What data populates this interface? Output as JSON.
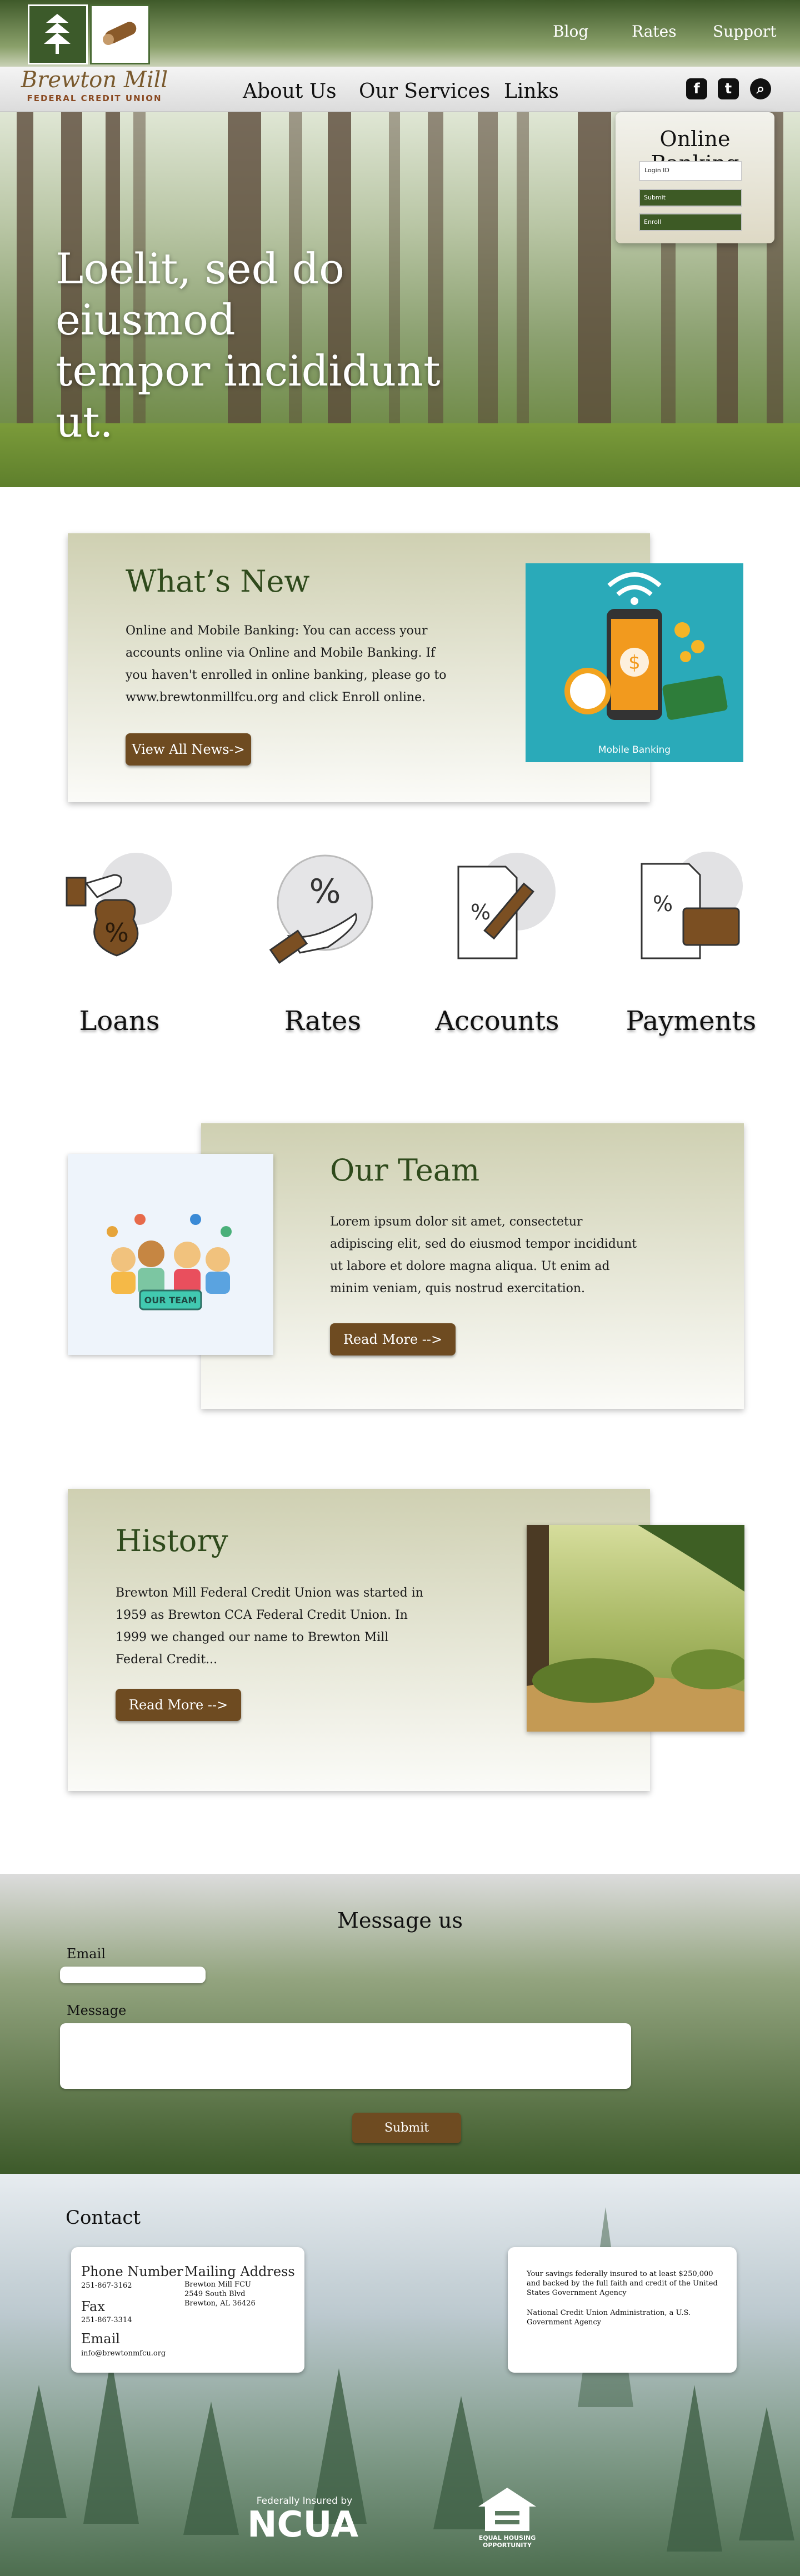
{
  "brand": {
    "name": "Brewton Mill",
    "subtitle": "FEDERAL CREDIT UNION"
  },
  "top_nav": {
    "blog": "Blog",
    "rates": "Rates",
    "support": "Support"
  },
  "main_nav": {
    "about": "About Us",
    "services": "Our Services",
    "links": "Links"
  },
  "social": {
    "facebook": "f",
    "twitter": "t",
    "search": "⌕"
  },
  "icons": {
    "facebook": "facebook-icon",
    "twitter": "twitter-icon",
    "search": "search-icon"
  },
  "hero": {
    "title_line1": "Loelit, sed do eiusmod",
    "title_line2": "tempor incididunt ut."
  },
  "online_banking": {
    "title": "Online Banking",
    "login_placeholder": "Login ID",
    "submit": "Submit",
    "enroll": "Enroll"
  },
  "whats_new": {
    "title": "What’s New",
    "text": "Online and Mobile Banking: You can access your accounts online via Online and Mobile Banking. If you haven't enrolled in online banking, please go to www.brewtonmillfcu.org and click Enroll online.",
    "button": "View All News->",
    "image_caption": "Mobile Banking"
  },
  "services": [
    {
      "label": "Loans"
    },
    {
      "label": "Rates"
    },
    {
      "label": "Accounts"
    },
    {
      "label": "Payments"
    }
  ],
  "team": {
    "title": "Our Team",
    "text": "Lorem ipsum dolor sit amet, consectetur adipiscing elit, sed do eiusmod tempor incididunt ut labore et dolore magna aliqua. Ut enim ad minim veniam, quis nostrud exercitation.",
    "button": "Read More -->",
    "badge": "OUR TEAM"
  },
  "history": {
    "title": "History",
    "text": "Brewton Mill Federal Credit Union was started in 1959 as Brewton CCA Federal Credit Union. In 1999 we changed our name to Brewton Mill Federal Credit...",
    "button": "Read More -->"
  },
  "message": {
    "title": "Message us",
    "email_label": "Email",
    "message_label": "Message",
    "submit": "Submit"
  },
  "contact": {
    "title": "Contact",
    "phone_label": "Phone Number",
    "phone": "251-867-3162",
    "fax_label": "Fax",
    "fax": "251-867-3314",
    "email_label": "Email",
    "email": "info@brewtonmfcu.org",
    "mailing_label": "Mailing Address",
    "addr1": "Brewton Mill FCU",
    "addr2": "2549 South Blvd",
    "addr3": "Brewton, AL 36426",
    "insured_text": "Your savings federally insured to at least $250,000 and backed by the full faith and credit of the United States Government Agency",
    "ncua_admin": "National Credit Union Administration, a U.S. Government Agency"
  },
  "footer": {
    "federally": "Federally Insured by",
    "ncua": "NCUA",
    "eho": "EQUAL HOUSING OPPORTUNITY"
  }
}
